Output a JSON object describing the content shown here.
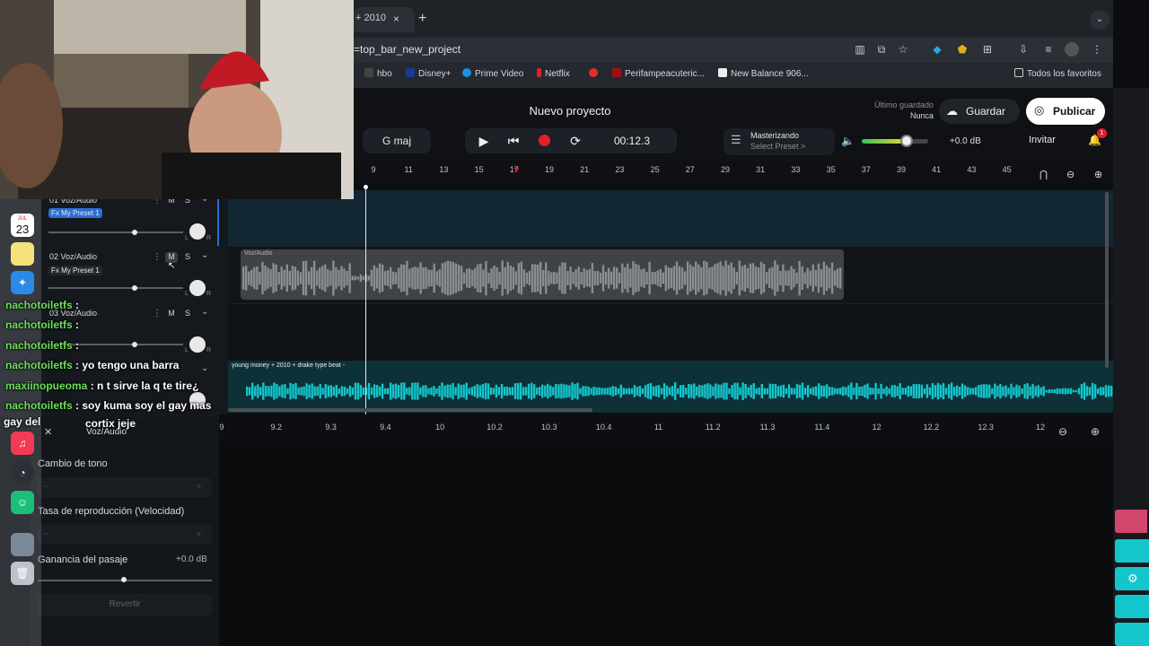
{
  "browser": {
    "tab_title": "+ 2010",
    "tab_close": "×",
    "tab_new": "+",
    "tab_dropdown": "⌄",
    "url": "=top_bar_new_project",
    "bookmarks": [
      "hbo",
      "Disney+",
      "Prime Video",
      "Netflix",
      "Perifampeacuteric...",
      "New Balance 906..."
    ],
    "all_favorites": "Todos los favoritos"
  },
  "app": {
    "project_title": "Nuevo proyecto",
    "last_saved_label": "Último guardado",
    "last_saved_value": "Nunca",
    "save_label": "Guardar",
    "publish_label": "Publicar",
    "key": "G maj",
    "time": "00:12.3",
    "mastering_title": "Masterizando",
    "mastering_preset": "Select Preset >",
    "gain": "+0.0 dB",
    "invite": "Invitar",
    "notif_count": "1"
  },
  "ruler": {
    "ticks": [
      "9",
      "11",
      "13",
      "15",
      "17",
      "19",
      "21",
      "23",
      "25",
      "27",
      "29",
      "31",
      "33",
      "35",
      "37",
      "39",
      "41",
      "43",
      "45"
    ]
  },
  "tracks": [
    {
      "number": "01",
      "name": "Voz/Audio",
      "fx": "Fx My Preset 1",
      "mute": "M",
      "solo": "S",
      "pan_l": "L",
      "pan_r": "R"
    },
    {
      "number": "02",
      "name": "Voz/Audio",
      "fx": "Fx My Preset 1",
      "mute": "M",
      "solo": "S",
      "pan_l": "L",
      "pan_r": "R"
    },
    {
      "number": "03",
      "name": "Voz/Audio",
      "fx": "",
      "mute": "M",
      "solo": "S",
      "pan_l": "L",
      "pan_r": "R"
    }
  ],
  "clips": {
    "voz_label": "Voz/Audio",
    "beat_label": "young money + 2010 + drake type beat -"
  },
  "lower_ruler": {
    "ticks": [
      "9",
      "9.2",
      "9.3",
      "9.4",
      "10",
      "10.2",
      "10.3",
      "10.4",
      "11",
      "11.2",
      "11.3",
      "11.4",
      "12",
      "12.2",
      "12.3",
      "12"
    ]
  },
  "inspector": {
    "title": "Voz/Audio",
    "pitch_label": "Cambio de tono",
    "speed_label": "Tasa de reproducción (Velocidad)",
    "gain_label": "Ganancia del pasaje",
    "gain_value": "+0.0 dB",
    "reset_label": "Revertir"
  },
  "dock": {
    "calendar_month": "JUL",
    "calendar_day": "23"
  },
  "chat": [
    {
      "user": "nachotoiletfs",
      "message": ":"
    },
    {
      "user": "nachotoiletfs",
      "message": ":"
    },
    {
      "user": "nachotoiletfs",
      "message": ":"
    },
    {
      "user": "nachotoiletfs",
      "message": ": yo tengo una barra"
    },
    {
      "user": "maxiinopueoma",
      "message": ": n t sirve la q te tire¿"
    },
    {
      "user": "nachotoiletfs",
      "message": ": soy kuma soy el gay mas"
    },
    {
      "user": "",
      "message": "gay del"
    },
    {
      "user": "",
      "message": "cortix jeje"
    }
  ],
  "colors": {
    "accent_teal": "#12c6cc",
    "record_red": "#e0202a",
    "chat_username": "#6ce05a",
    "fx_badge_blue": "#2a6fd6"
  }
}
